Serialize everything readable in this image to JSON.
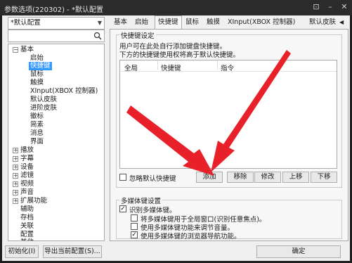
{
  "window": {
    "title": "参数选项(220302) - *默认配置"
  },
  "profile_combo": {
    "value": "*默认配置"
  },
  "tree": {
    "root": "基本",
    "children": [
      "启始",
      "快捷键",
      "鼠标",
      "触摸",
      "XInput(XBOX 控制器)",
      "默认皮肤",
      "进阶皮肤",
      "徽标",
      "简素",
      "消息",
      "界面"
    ],
    "others": [
      "播放",
      "字幕",
      "设备",
      "滤镜",
      "视频",
      "声音",
      "扩展功能",
      "辅助",
      "存档",
      "关联",
      "配置",
      "其他"
    ]
  },
  "tabs": [
    "基本",
    "启始",
    "快捷键",
    "鼠标",
    "触摸",
    "XInput(XBOX 控制器)",
    "默认皮肤"
  ],
  "hotkeys": {
    "group_title": "快捷键设定",
    "desc1": "用户可在此处自行添加键盘快捷键。",
    "desc2": "下方的快捷键使用权将高于默认快捷键。",
    "columns": [
      "全局",
      "快捷键",
      "指令"
    ],
    "ignore_default": "忽略默认快捷键",
    "buttons": [
      "添加",
      "移除",
      "修改",
      "上移",
      "下移"
    ]
  },
  "media": {
    "group_title": "多媒体键设置",
    "options": [
      {
        "label": "识别多媒体键。",
        "checked": true
      },
      {
        "label": "将多媒体键用于全局窗口(识别任意焦点)。",
        "checked": false
      },
      {
        "label": "使用多媒体键功能来调节音量。",
        "checked": false
      },
      {
        "label": "使用多媒体键的浏览器导航功能。",
        "checked": true
      }
    ]
  },
  "footer": {
    "init": "初始化(I)",
    "export": "导出当前配置(S)...",
    "confirm": "确定"
  }
}
